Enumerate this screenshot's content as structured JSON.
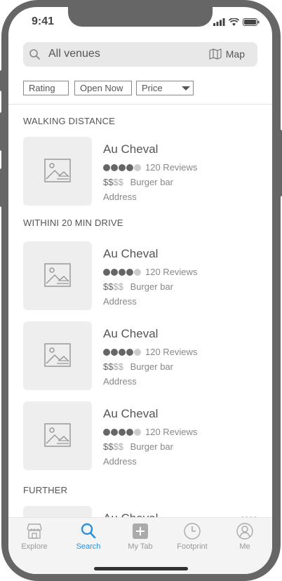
{
  "status": {
    "time": "9:41"
  },
  "search": {
    "placeholder": "All venues",
    "map_label": "Map"
  },
  "filters": {
    "rating": "Rating",
    "open_now": "Open Now",
    "price": "Price"
  },
  "sections": [
    {
      "title": "WALKING DISTANCE"
    },
    {
      "title": "WITHINI 20 MIN DRIVE"
    },
    {
      "title": "FURTHER"
    }
  ],
  "venues": [
    {
      "name": "Au Cheval",
      "rating_filled": 4,
      "rating_total": 5,
      "reviews": "120 Reviews",
      "price_on": "$$",
      "price_off": "$$",
      "category": "Burger bar",
      "address": "Address"
    },
    {
      "name": "Au Cheval",
      "rating_filled": 4,
      "rating_total": 5,
      "reviews": "120 Reviews",
      "price_on": "$$",
      "price_off": "$$",
      "category": "Burger bar",
      "address": "Address"
    },
    {
      "name": "Au Cheval",
      "rating_filled": 4,
      "rating_total": 5,
      "reviews": "120 Reviews",
      "price_on": "$$",
      "price_off": "$$",
      "category": "Burger bar",
      "address": "Address"
    },
    {
      "name": "Au Cheval",
      "rating_filled": 4,
      "rating_total": 5,
      "reviews": "120 Reviews",
      "price_on": "$$",
      "price_off": "$$",
      "category": "Burger bar",
      "address": "Address"
    }
  ],
  "partial_venue": {
    "name": "Au Cheval",
    "price": "$$$$"
  },
  "tabbar": {
    "explore": "Explore",
    "search": "Search",
    "my_tab": "My Tab",
    "footprint": "Footprint",
    "me": "Me"
  },
  "colors": {
    "accent": "#2b8fdb",
    "frame": "#666666"
  }
}
